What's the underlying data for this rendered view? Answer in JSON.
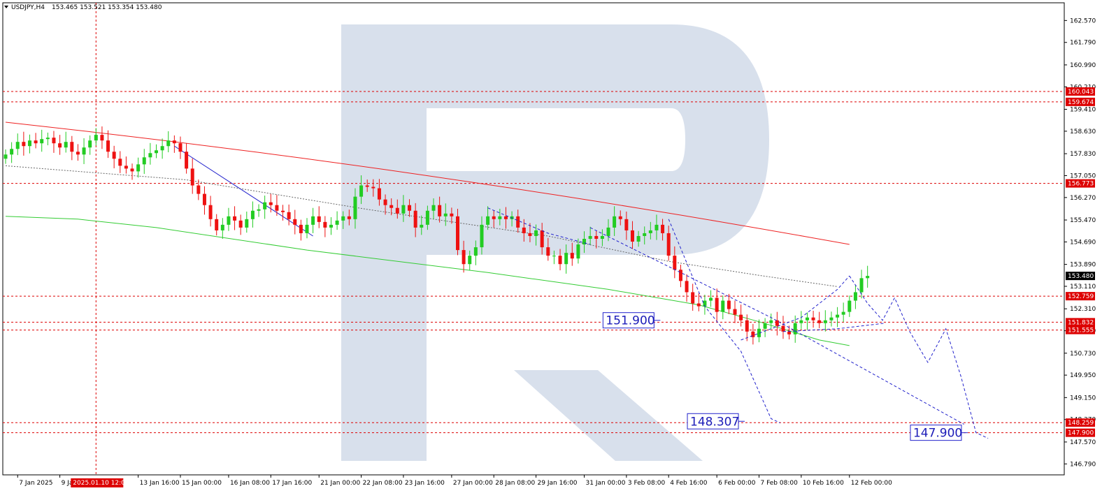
{
  "header": {
    "symbol": "USDJPY,H4",
    "ohlc": "153.465 153.521 153.354 153.480"
  },
  "crosshair": {
    "time_label": "2025.01.10 12:00"
  },
  "colors": {
    "bull": "#22cc22",
    "bear": "#ee1111",
    "ma_red": "#ee2222",
    "ma_green": "#33cc33",
    "level": "#dd0000",
    "forecast": "#2222cc",
    "watermark": "#d8e0ec"
  },
  "chart_data": {
    "type": "candlestick",
    "title": "",
    "ylim": [
      146.4,
      163.2
    ],
    "yticks": [
      162.57,
      161.79,
      160.99,
      160.21,
      159.41,
      158.63,
      157.83,
      157.05,
      156.27,
      155.47,
      154.69,
      153.89,
      153.11,
      152.31,
      151.53,
      150.73,
      149.95,
      149.15,
      148.37,
      147.57,
      146.79
    ],
    "x_count": 144,
    "xticks": [
      {
        "i": 2,
        "label": "7 Jan 2025"
      },
      {
        "i": 9,
        "label": "9 Jan 00:00"
      },
      {
        "i": 22,
        "label": "13 Jan 16:00"
      },
      {
        "i": 29,
        "label": "15 Jan 00:00"
      },
      {
        "i": 37,
        "label": "16 Jan 08:00"
      },
      {
        "i": 44,
        "label": "17 Jan 16:00"
      },
      {
        "i": 52,
        "label": "21 Jan 00:00"
      },
      {
        "i": 59,
        "label": "22 Jan 08:00"
      },
      {
        "i": 66,
        "label": "23 Jan 16:00"
      },
      {
        "i": 74,
        "label": "27 Jan 00:00"
      },
      {
        "i": 81,
        "label": "28 Jan 08:00"
      },
      {
        "i": 88,
        "label": "29 Jan 16:00"
      },
      {
        "i": 96,
        "label": "31 Jan 00:00"
      },
      {
        "i": 103,
        "label": "3 Feb 08:00"
      },
      {
        "i": 110,
        "label": "4 Feb 16:00"
      },
      {
        "i": 118,
        "label": "6 Feb 00:00"
      },
      {
        "i": 125,
        "label": "7 Feb 08:00"
      },
      {
        "i": 132,
        "label": "10 Feb 16:00"
      },
      {
        "i": 140,
        "label": "12 Feb 00:00"
      }
    ],
    "crosshair_index": 15,
    "series_close": [
      157.8,
      158.0,
      158.25,
      158.1,
      158.3,
      158.2,
      158.35,
      158.4,
      158.2,
      158.05,
      158.25,
      157.9,
      157.8,
      158.05,
      158.3,
      158.5,
      158.3,
      157.9,
      157.65,
      157.4,
      157.3,
      157.2,
      157.45,
      157.7,
      157.85,
      157.95,
      158.1,
      158.3,
      158.2,
      157.9,
      157.3,
      156.7,
      156.4,
      156.0,
      155.5,
      155.1,
      155.3,
      155.6,
      155.45,
      155.2,
      155.5,
      155.8,
      155.85,
      156.1,
      156.0,
      155.8,
      155.75,
      155.5,
      155.3,
      155.0,
      155.3,
      155.6,
      155.4,
      155.2,
      155.3,
      155.45,
      155.6,
      155.5,
      156.3,
      156.7,
      156.65,
      156.6,
      156.2,
      156.0,
      155.9,
      155.7,
      156.0,
      155.8,
      155.2,
      155.3,
      155.8,
      156.0,
      155.6,
      155.7,
      155.6,
      154.4,
      153.9,
      154.2,
      154.5,
      155.3,
      155.6,
      155.5,
      155.6,
      155.5,
      155.6,
      155.2,
      155.0,
      154.9,
      155.1,
      154.5,
      154.2,
      154.2,
      153.9,
      154.3,
      154.1,
      154.6,
      154.8,
      154.9,
      154.8,
      154.9,
      155.2,
      155.6,
      155.5,
      155.1,
      154.7,
      154.9,
      155.0,
      155.1,
      155.3,
      155.0,
      154.2,
      153.7,
      153.3,
      152.9,
      152.5,
      152.4,
      152.6,
      152.7,
      152.2,
      152.6,
      152.3,
      152.1,
      151.9,
      151.5,
      151.3,
      151.6,
      151.8,
      151.9,
      151.7,
      151.5,
      151.4,
      151.8,
      151.9,
      152.0,
      151.9,
      151.8,
      151.9,
      152.0,
      152.1,
      152.2,
      152.6,
      152.9,
      153.4,
      153.48
    ],
    "ma_red": [
      [
        0,
        158.95
      ],
      [
        140,
        154.6
      ]
    ],
    "ma_green": [
      [
        0,
        155.6
      ],
      [
        12,
        155.5
      ],
      [
        25,
        155.2
      ],
      [
        50,
        154.4
      ],
      [
        80,
        153.6
      ],
      [
        100,
        153.0
      ],
      [
        115,
        152.45
      ],
      [
        125,
        151.85
      ],
      [
        135,
        151.2
      ],
      [
        140,
        151.0
      ]
    ],
    "ma_grey": [
      [
        0,
        157.4
      ],
      [
        30,
        156.9
      ],
      [
        60,
        155.85
      ],
      [
        90,
        154.9
      ],
      [
        110,
        154.0
      ],
      [
        125,
        153.5
      ],
      [
        138,
        153.1
      ]
    ],
    "levels": [
      {
        "value": 160.043,
        "label": "160.043"
      },
      {
        "value": 159.674,
        "label": "159.674"
      },
      {
        "value": 156.773,
        "label": "156.773"
      },
      {
        "value": 152.759,
        "label": "152.759"
      },
      {
        "value": 151.832,
        "label": "151.832"
      },
      {
        "value": 151.555,
        "label": "151.555"
      },
      {
        "value": 148.259,
        "label": "148.259"
      },
      {
        "value": 147.9,
        "label": "147.900"
      }
    ],
    "current_price": {
      "value": 153.48,
      "label": "153.480"
    },
    "forecast_boxes": [
      {
        "value": 151.9,
        "label": "151.900",
        "i": 107
      },
      {
        "value": 148.307,
        "label": "148.307",
        "i": 121
      },
      {
        "value": 147.9,
        "label": "147.900",
        "i": 158
      }
    ],
    "forecast_main": [
      [
        140,
        153.48
      ],
      [
        143,
        152.5
      ],
      [
        145.5,
        151.9
      ],
      [
        147.5,
        152.7
      ],
      [
        150,
        151.5
      ],
      [
        153,
        150.4
      ],
      [
        156,
        151.6
      ],
      [
        158.5,
        149.9
      ],
      [
        161,
        147.9
      ],
      [
        163,
        147.7
      ]
    ],
    "forecast_alt": [
      [
        [
          110,
          155.5
        ],
        [
          116,
          152.4
        ],
        [
          122,
          150.8
        ],
        [
          127,
          148.4
        ],
        [
          128.5,
          148.25
        ]
      ],
      [
        [
          97,
          155.2
        ],
        [
          127,
          152.0
        ],
        [
          159,
          148.2
        ]
      ],
      [
        [
          129,
          151.5
        ],
        [
          138,
          151.6
        ],
        [
          146,
          151.8
        ]
      ],
      [
        [
          122,
          151.2
        ],
        [
          132,
          152.0
        ],
        [
          138,
          153.0
        ],
        [
          140,
          153.48
        ]
      ],
      [
        [
          80,
          155.9
        ],
        [
          90,
          155.0
        ],
        [
          97,
          154.6
        ]
      ]
    ],
    "trend_line_blue": [
      [
        28,
        158.1
      ],
      [
        51,
        154.9
      ]
    ]
  }
}
